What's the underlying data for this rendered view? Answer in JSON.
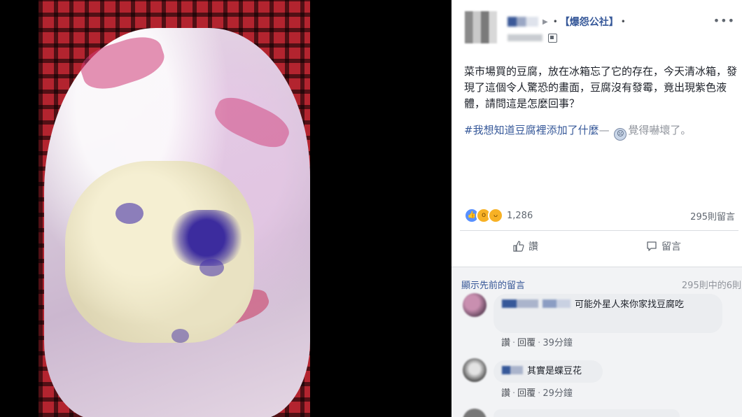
{
  "group": {
    "name": "【爆怨公社】"
  },
  "post": {
    "text": "菜市場買的豆腐，放在冰箱忘了它的存在，今天清冰箱，發現了這個令人驚恐的畫面，豆腐沒有發霉，竟出現紫色液體，請問這是怎麼回事？",
    "hashtag": "#我想知道豆腐裡添加了什麼",
    "feeling_dash": "—",
    "feeling": "覺得嚇壞了。"
  },
  "stats": {
    "reactions_count": "1,286",
    "comments_label": "295則留言"
  },
  "actions": {
    "like_label": "讚",
    "comment_label": "留言"
  },
  "comments_section": {
    "prev_label": "顯示先前的留言",
    "of_count": "295則中的6則",
    "items": [
      {
        "text": "可能外星人來你家找豆腐吃",
        "like": "讚",
        "reply": "回覆",
        "time": "39分鐘"
      },
      {
        "text": "其實是蝶豆花",
        "like": "讚",
        "reply": "回覆",
        "time": "29分鐘"
      }
    ]
  },
  "icons": {
    "more": "more-options-icon",
    "privacy": "public-privacy-icon",
    "like": "thumbs-up-icon",
    "comment": "comment-bubble-icon"
  },
  "colors": {
    "link": "#365899",
    "muted": "#90949c",
    "bubble": "#ebedf0"
  }
}
